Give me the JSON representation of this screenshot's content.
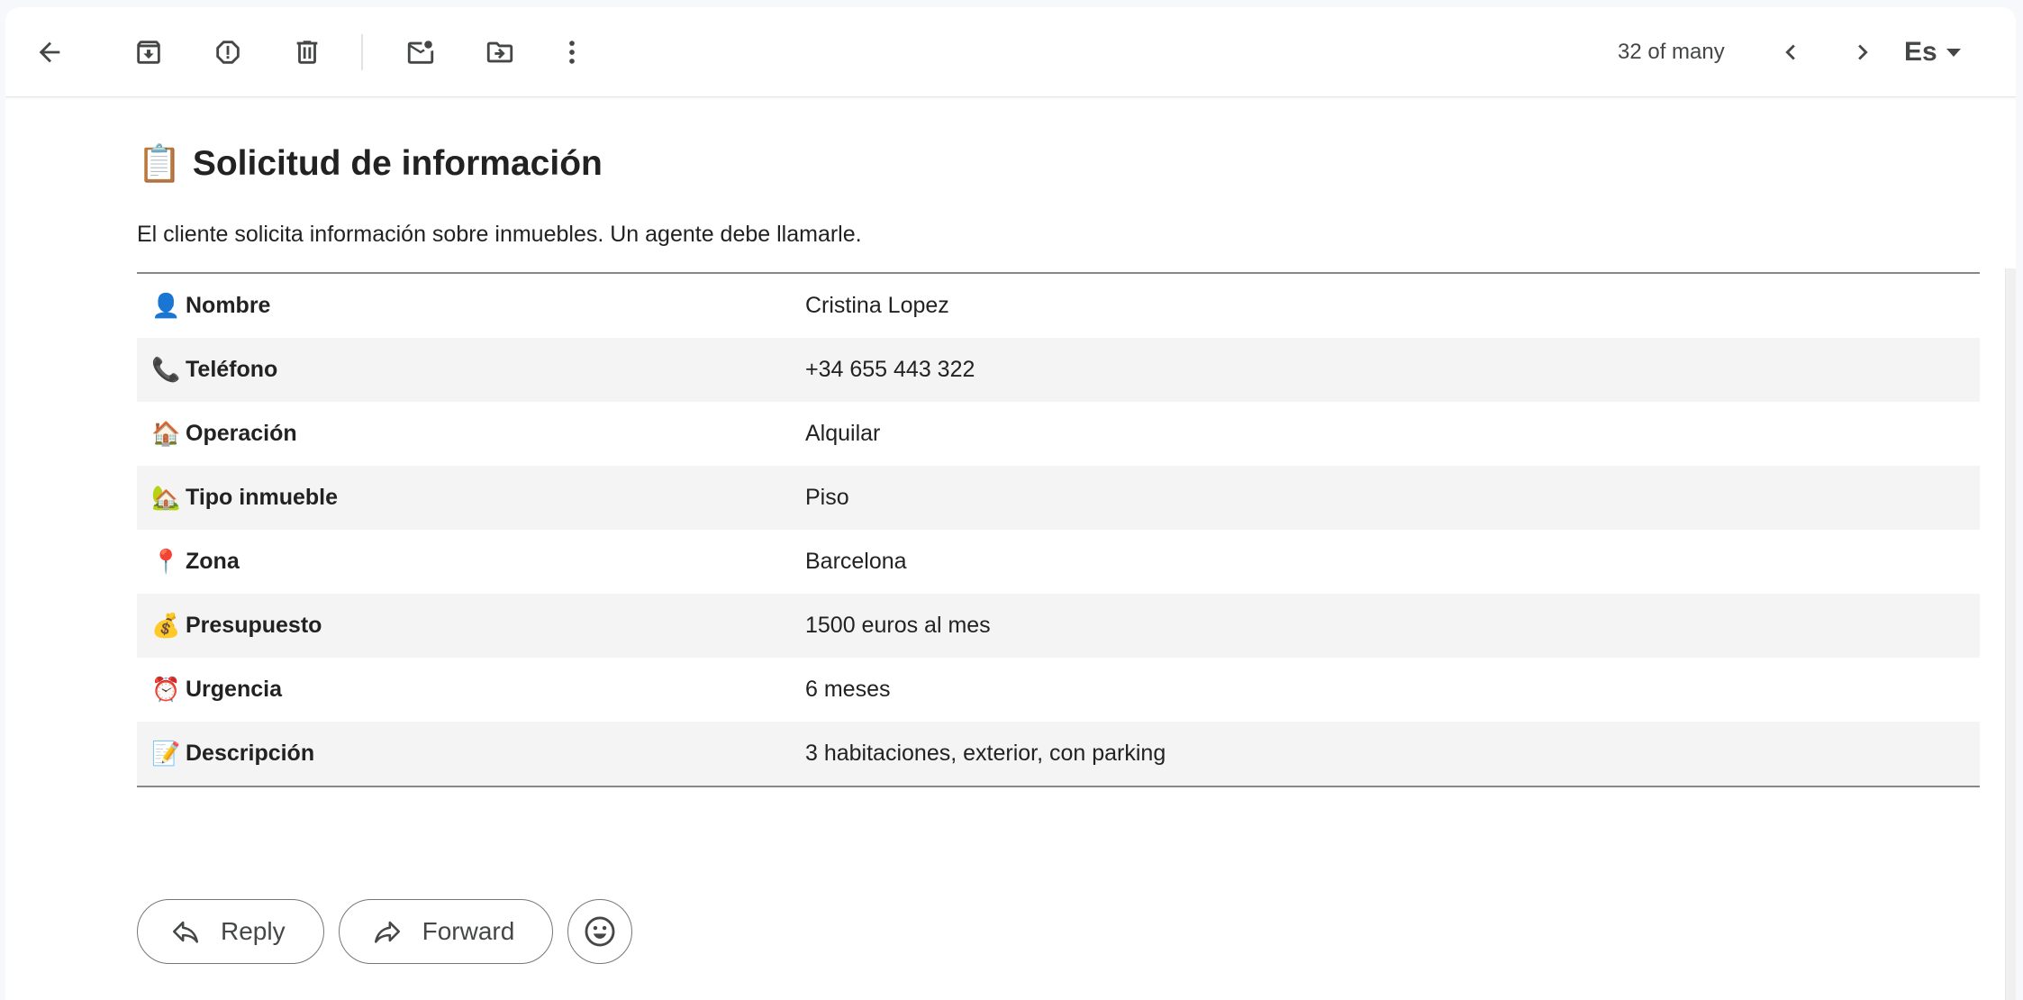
{
  "toolbar": {
    "counter": "32 of many",
    "language": "Es"
  },
  "email": {
    "title_emoji": "📋",
    "title": "Solicitud de información",
    "subtitle": "El cliente solicita información sobre inmuebles. Un agente debe llamarle.",
    "rows": [
      {
        "icon": "👤",
        "label": "Nombre",
        "value": "Cristina Lopez"
      },
      {
        "icon": "📞",
        "label": "Teléfono",
        "value": "+34 655 443 322"
      },
      {
        "icon": "🏠",
        "label": "Operación",
        "value": "Alquilar"
      },
      {
        "icon": "🏡",
        "label": "Tipo inmueble",
        "value": "Piso"
      },
      {
        "icon": "📍",
        "label": "Zona",
        "value": "Barcelona"
      },
      {
        "icon": "💰",
        "label": "Presupuesto",
        "value": "1500 euros al mes"
      },
      {
        "icon": "⏰",
        "label": "Urgencia",
        "value": "6 meses"
      },
      {
        "icon": "📝",
        "label": "Descripción",
        "value": "3 habitaciones, exterior, con parking"
      }
    ]
  },
  "actions": {
    "reply": "Reply",
    "forward": "Forward"
  }
}
